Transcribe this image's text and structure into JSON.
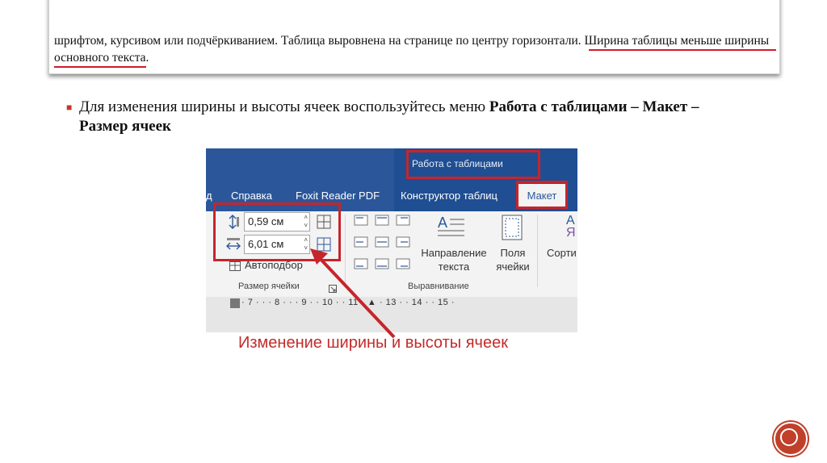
{
  "excerpt": {
    "line1": "шрифтом, курсивом или подчёркиванием. Таблица выровнена на странице по центру горизонтали.",
    "line1_highlight": "Ширина таблицы меньше ширины",
    "line2_highlight": "основного текста",
    "line2_tail": "."
  },
  "bullet": {
    "text_plain": "Для изменения ширины и высоты ячеек воспользуйтесь меню ",
    "text_bold": "Работа с таблицами – Макет – Размер ячеек"
  },
  "word": {
    "context_title": "Работа с таблицами",
    "tabs": [
      "д",
      "Справка",
      "Foxit Reader PDF",
      "Конструктор таблиц"
    ],
    "active_tab": "Макет",
    "height_value": "0,59 см",
    "width_value": "6,01 см",
    "autofit_label": "Автоподбор",
    "group_cell_size": "Размер ячейки",
    "group_alignment": "Выравнивание",
    "text_direction_label_1": "Направление",
    "text_direction_label_2": "текста",
    "margins_label_1": "Поля",
    "margins_label_2": "ячейки",
    "sort_label": "Сорти",
    "ruler": "· 7 · · · 8 · · · 9 · · 10 · · 11 · ▲ · 13 · · 14 · · 15 ·"
  },
  "caption": "Изменение ширины и высоты ячеек",
  "colors": {
    "accent": "#c6252b",
    "ribbon_blue": "#2b579a"
  }
}
